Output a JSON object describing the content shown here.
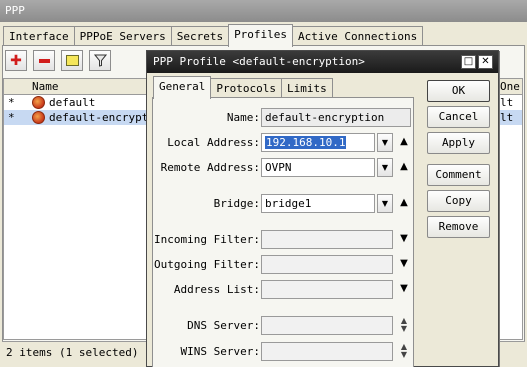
{
  "ppp_window": {
    "title": "PPP",
    "tabs": [
      {
        "label": "Interface",
        "active": false
      },
      {
        "label": "PPPoE Servers",
        "active": false
      },
      {
        "label": "Secrets",
        "active": false
      },
      {
        "label": "Profiles",
        "active": true
      },
      {
        "label": "Active Connections",
        "active": false
      }
    ],
    "toolbar": {
      "add_icon": "plus-icon",
      "remove_icon": "minus-icon",
      "comment_icon": "note-icon",
      "filter_icon": "filter-icon",
      "add_color": "#d11c1c",
      "remove_color": "#d11c1c",
      "comment_color": "#f5e65a"
    },
    "list": {
      "columns": {
        "name": "Name",
        "only_one": "One"
      },
      "rows": [
        {
          "mark": "*",
          "name": "default",
          "only_one": "lt",
          "selected": false
        },
        {
          "mark": "*",
          "name": "default-encryptio",
          "only_one": "lt",
          "selected": true
        }
      ]
    },
    "status": "2 items (1 selected)"
  },
  "dialog": {
    "title": "PPP Profile <default-encryption>",
    "title_buttons": {
      "restore": "□",
      "close": "✕"
    },
    "tabs": [
      {
        "label": "General",
        "active": true
      },
      {
        "label": "Protocols",
        "active": false
      },
      {
        "label": "Limits",
        "active": false
      }
    ],
    "fields": {
      "name": {
        "label": "Name:",
        "value": "default-encryption"
      },
      "local_address": {
        "label": "Local Address:",
        "value": "192.168.10.1"
      },
      "remote_address": {
        "label": "Remote Address:",
        "value": "OVPN"
      },
      "bridge": {
        "label": "Bridge:",
        "value": "bridge1"
      },
      "incoming_filter": {
        "label": "Incoming Filter:",
        "value": ""
      },
      "outgoing_filter": {
        "label": "Outgoing Filter:",
        "value": ""
      },
      "address_list": {
        "label": "Address List:",
        "value": ""
      },
      "dns_server": {
        "label": "DNS Server:",
        "value": ""
      },
      "wins_server": {
        "label": "WINS Server:",
        "value": ""
      }
    },
    "buttons": {
      "ok": "OK",
      "cancel": "Cancel",
      "apply": "Apply",
      "comment": "Comment",
      "copy": "Copy",
      "remove": "Remove"
    },
    "accent_selection": "#3169c6"
  }
}
